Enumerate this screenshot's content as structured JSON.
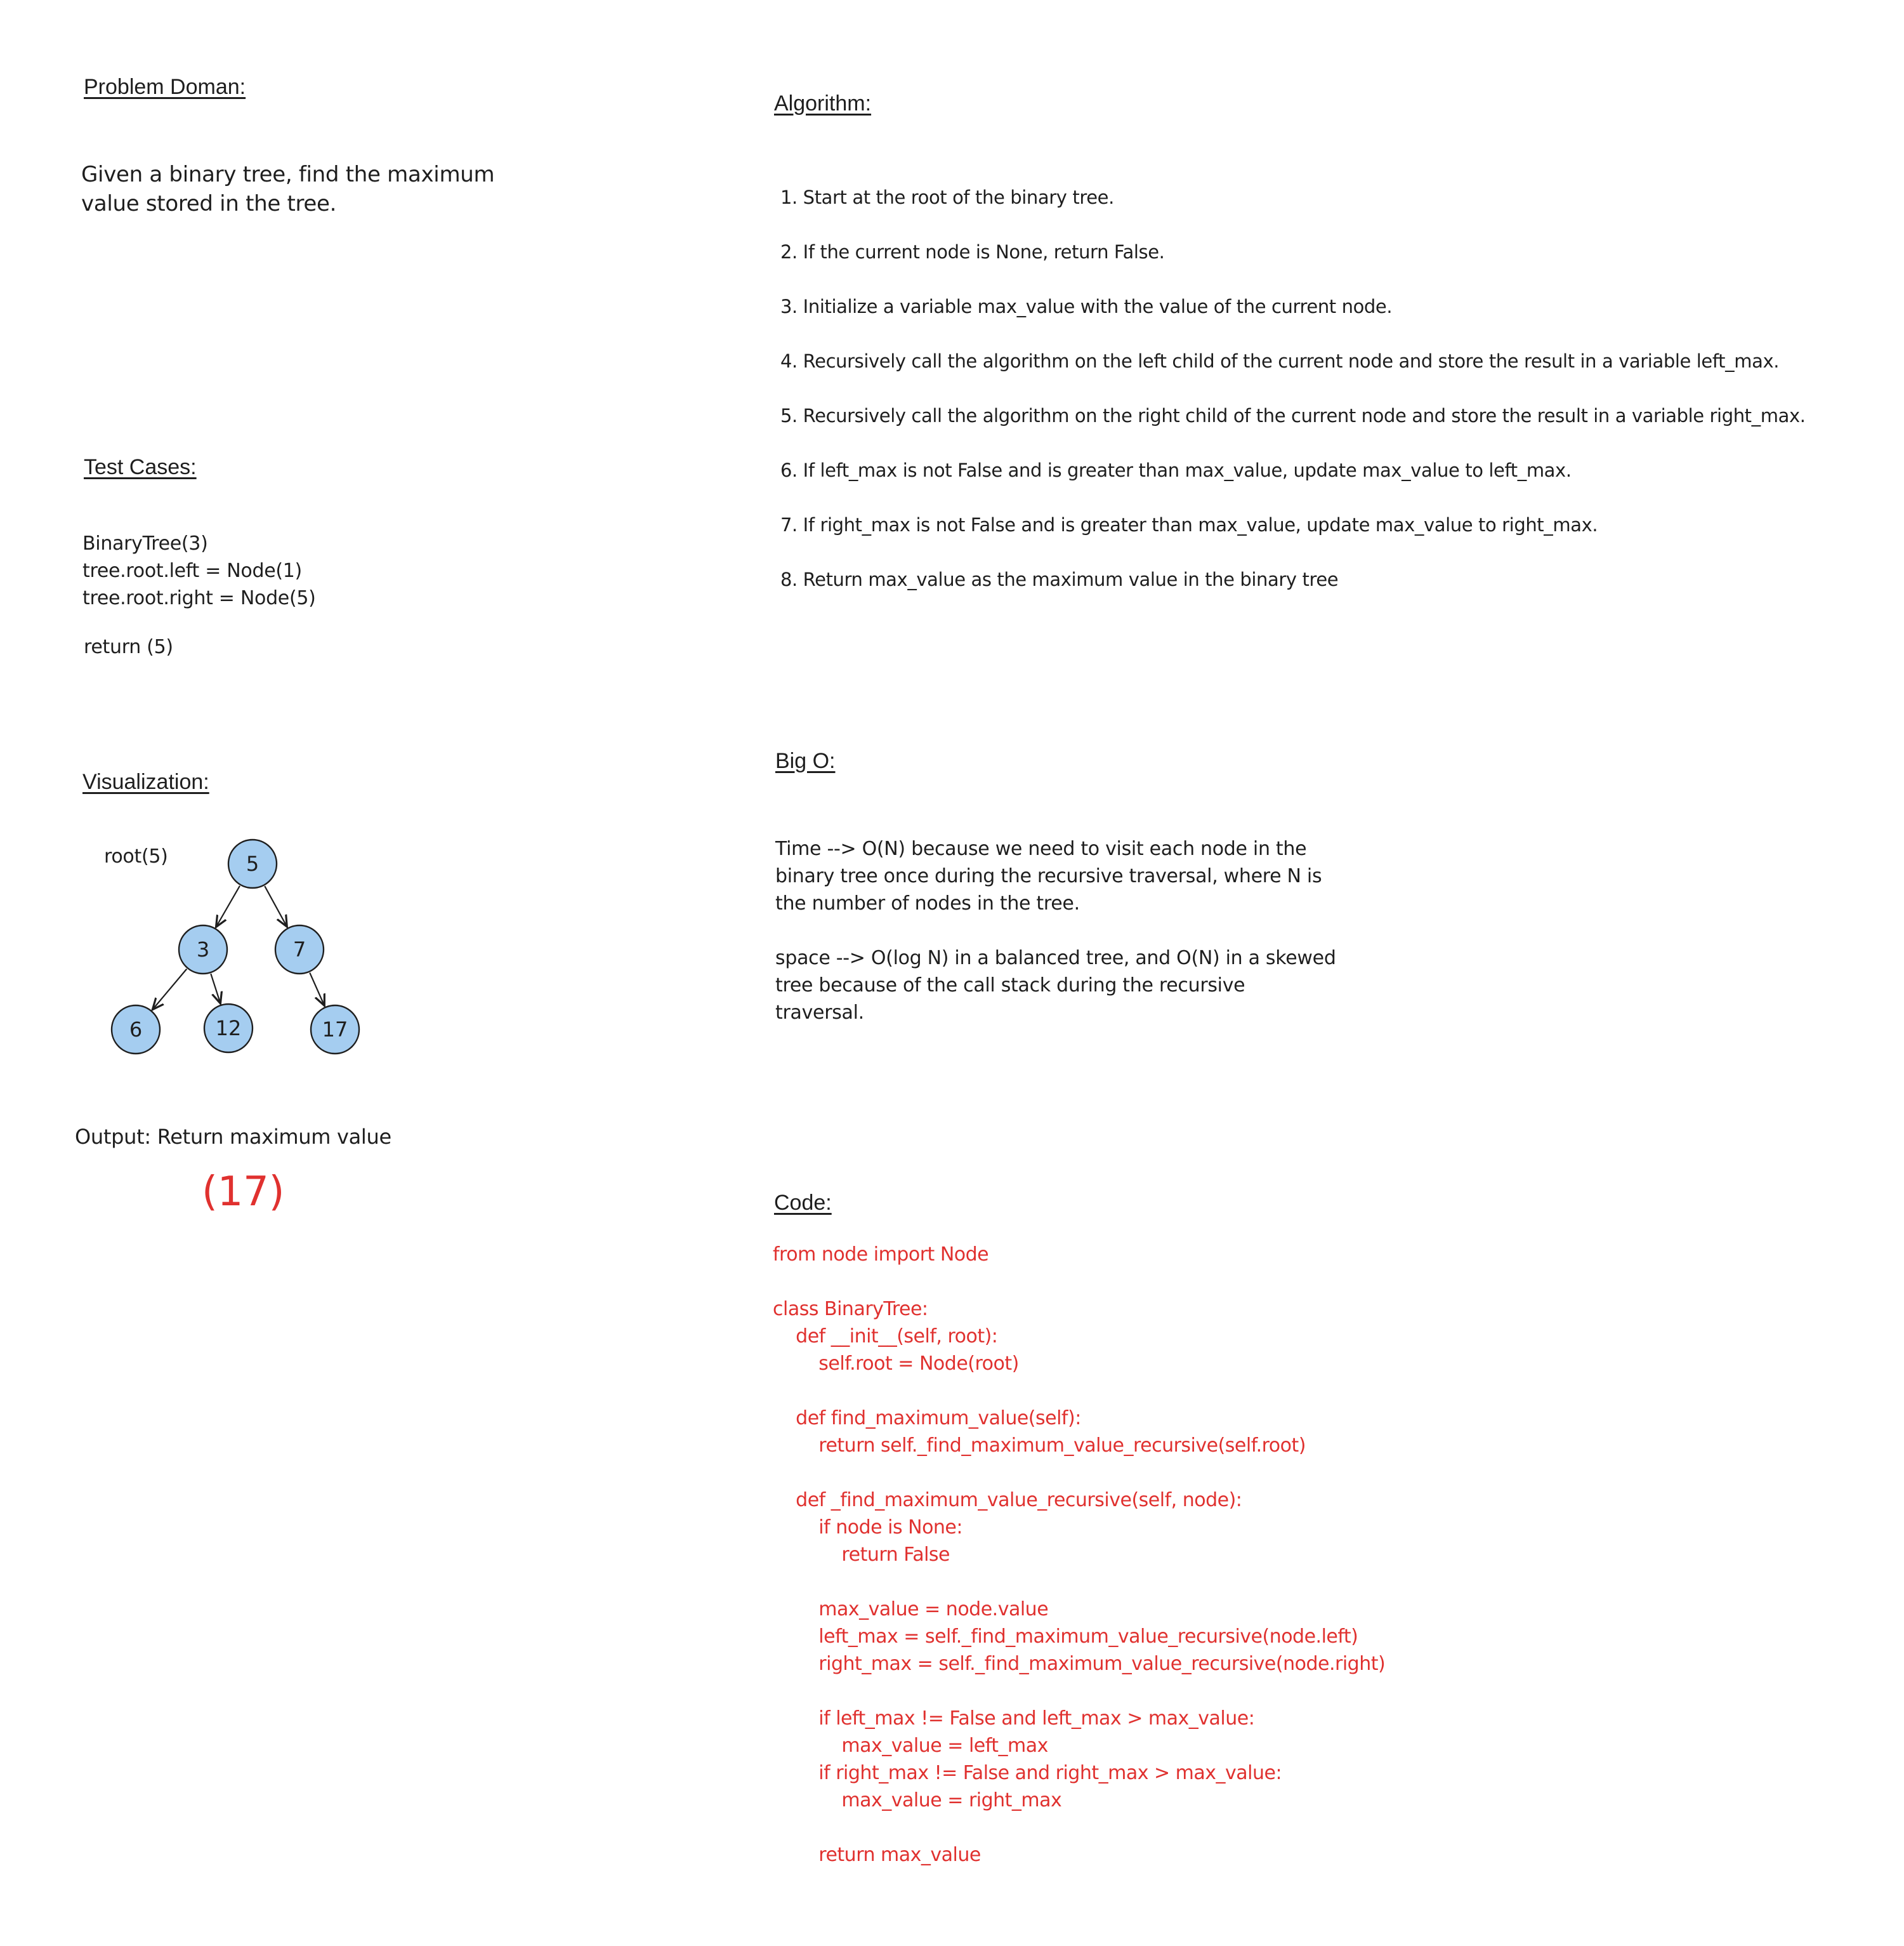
{
  "problem": {
    "heading": "Problem Doman:",
    "lines": [
      "Given a binary tree, find the maximum",
      "value stored in the tree."
    ]
  },
  "test_cases": {
    "heading": "Test Cases:",
    "lines": [
      " BinaryTree(3)",
      "tree.root.left = Node(1)",
      "tree.root.right = Node(5)"
    ],
    "result": "return (5)"
  },
  "visualization": {
    "heading": "Visualization:",
    "root_label": "root(5)",
    "node_fill": "#a5cdf0",
    "nodes": [
      {
        "id": "n5",
        "label": "5"
      },
      {
        "id": "n3",
        "label": "3"
      },
      {
        "id": "n7",
        "label": "7"
      },
      {
        "id": "n6",
        "label": "6"
      },
      {
        "id": "n12",
        "label": "12"
      },
      {
        "id": "n17",
        "label": "17"
      }
    ],
    "edges": [
      [
        "n5",
        "n3"
      ],
      [
        "n5",
        "n7"
      ],
      [
        "n3",
        "n6"
      ],
      [
        "n3",
        "n12"
      ],
      [
        "n7",
        "n17"
      ]
    ]
  },
  "output": {
    "label": "Output: Return maximum value",
    "value": "(17)",
    "color": "#e0312f"
  },
  "algorithm": {
    "heading": "Algorithm:",
    "steps": [
      "1. Start at the root of the binary tree.",
      "2. If the current node is None, return False.",
      "3. Initialize a variable max_value with the value of the current node.",
      "4. Recursively call the algorithm on the left child of the current node and store the result in a variable left_max.",
      "5. Recursively call the algorithm on the right child of the current node and store the result in a variable right_max.",
      "6. If left_max is not False and is greater than max_value, update max_value to left_max.",
      "7. If right_max is not False and is greater than max_value, update max_value to right_max.",
      "8. Return max_value as the maximum value in the binary tree"
    ]
  },
  "big_o": {
    "heading": "Big O:",
    "time": [
      "Time --> O(N) because we need to visit each node in the",
      "binary tree once during the recursive traversal, where N is",
      "the number of nodes in the tree."
    ],
    "space": [
      "space --> O(log N) in a balanced tree, and O(N) in a skewed",
      "tree because of the call stack during the recursive",
      "traversal."
    ]
  },
  "code": {
    "heading": "Code:",
    "text": "from node import Node\n\nclass BinaryTree:\n    def __init__(self, root):\n        self.root = Node(root)\n\n    def find_maximum_value(self):\n        return self._find_maximum_value_recursive(self.root)\n\n    def _find_maximum_value_recursive(self, node):\n        if node is None:\n            return False\n\n        max_value = node.value\n        left_max = self._find_maximum_value_recursive(node.left)\n        right_max = self._find_maximum_value_recursive(node.right)\n\n        if left_max != False and left_max > max_value:\n            max_value = left_max\n        if right_max != False and right_max > max_value:\n            max_value = right_max\n\n        return max_value"
  }
}
